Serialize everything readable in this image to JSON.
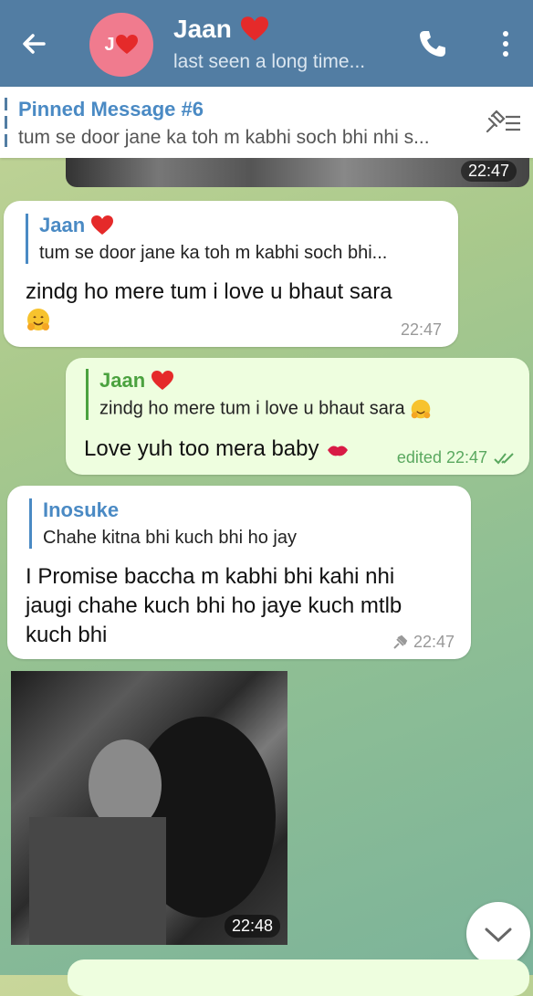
{
  "header": {
    "title": "Jaan",
    "subtitle": "last seen a long time...",
    "avatar_text": "J",
    "bg_color": "#527da3"
  },
  "pinned": {
    "title": "Pinned Message #6",
    "text": "tum se door jane ka toh m kabhi soch bhi nhi s..."
  },
  "photo_top": {
    "time": "22:47"
  },
  "messages": [
    {
      "side": "in",
      "reply_name": "Jaan",
      "reply_text": "tum se door jane ka toh m kabhi soch bhi...",
      "text": "zindg ho mere tum i love u bhaut sara",
      "time": "22:47"
    },
    {
      "side": "out",
      "reply_name": "Jaan",
      "reply_text": "zindg ho mere tum i love u bhaut sara",
      "text": "Love yuh too mera baby",
      "time": "edited 22:47"
    },
    {
      "side": "in",
      "reply_name": "Inosuke",
      "reply_text": "Chahe kitna bhi kuch bhi ho jay",
      "text_lines": [
        "I Promise baccha m kabhi bhi kahi nhi",
        "jaugi chahe kuch bhi ho jaye kuch mtlb",
        "kuch bhi"
      ],
      "time": "22:47"
    }
  ],
  "image_message": {
    "time": "22:48"
  },
  "icons": {
    "back": "back-arrow-icon",
    "call": "phone-icon",
    "menu": "more-vert-icon",
    "unpin": "unpin-list-icon",
    "scroll": "chevron-down-icon"
  },
  "colors": {
    "accent": "#4a8ac4",
    "green_name": "#4ba23f",
    "out_bubble": "#eefedf"
  }
}
